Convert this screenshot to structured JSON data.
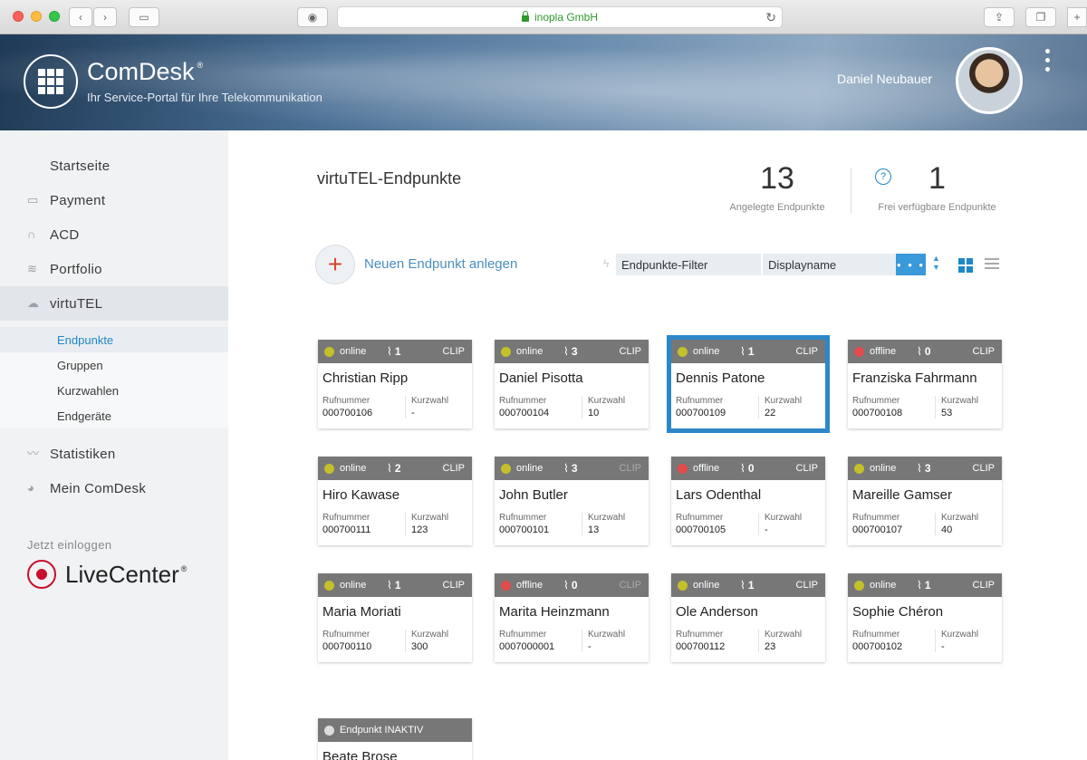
{
  "browser": {
    "address": "inopla GmbH"
  },
  "header": {
    "brand": "ComDesk",
    "brand_mark": "®",
    "tagline": "Ihr Service-Portal für Ihre Telekommunikation",
    "user_name": "Daniel Neubauer"
  },
  "sidebar": {
    "items": [
      {
        "label": "Startseite",
        "icon": "home-icon"
      },
      {
        "label": "Payment",
        "icon": "folder-icon"
      },
      {
        "label": "ACD",
        "icon": "headset-icon"
      },
      {
        "label": "Portfolio",
        "icon": "layers-icon"
      },
      {
        "label": "virtuTEL",
        "icon": "cloud-icon"
      }
    ],
    "sub_items": [
      "Endpunkte",
      "Gruppen",
      "Kurzwahlen",
      "Endgeräte"
    ],
    "bottom_items": [
      {
        "label": "Statistiken",
        "icon": "chart-icon"
      },
      {
        "label": "Mein ComDesk",
        "icon": "user-icon"
      }
    ],
    "login_hint": "Jetzt einloggen",
    "livecenter": "LiveCenter",
    "livecenter_mark": "®"
  },
  "main": {
    "title": "virtuTEL-Endpunkte",
    "stats": [
      {
        "value": "13",
        "label": "Angelegte Endpunkte"
      },
      {
        "value": "1",
        "label": "Frei verfügbare Endpunkte"
      }
    ],
    "add_label": "Neuen Endpunkt anlegen",
    "filter_value": "Endpunkte-Filter",
    "sort_value": "Displayname",
    "filter_more": "• • •",
    "col_label_1": "Rufnummer",
    "col_label_2": "Kurzwahl"
  },
  "colors": {
    "online": "#c3c02a",
    "offline": "#e44b4b",
    "inactive": "#dddddd",
    "accent": "#2b87c8"
  },
  "cards": [
    {
      "status": "online",
      "count": "1",
      "clip": "CLIP",
      "clip_dim": false,
      "name": "Christian Ripp",
      "number": "000700106",
      "short": "-"
    },
    {
      "status": "online",
      "count": "3",
      "clip": "CLIP",
      "clip_dim": false,
      "name": "Daniel Pisotta",
      "number": "000700104",
      "short": "10"
    },
    {
      "status": "online",
      "count": "1",
      "clip": "CLIP",
      "clip_dim": false,
      "name": "Dennis Patone",
      "number": "000700109",
      "short": "22",
      "selected": true
    },
    {
      "status": "offline",
      "count": "0",
      "clip": "CLIP",
      "clip_dim": false,
      "name": "Franziska Fahrmann",
      "number": "000700108",
      "short": "53"
    },
    {
      "status": "online",
      "count": "2",
      "clip": "CLIP",
      "clip_dim": false,
      "name": "Hiro Kawase",
      "number": "000700111",
      "short": "123"
    },
    {
      "status": "online",
      "count": "3",
      "clip": "CLIP",
      "clip_dim": true,
      "name": "John Butler",
      "number": "000700101",
      "short": "13"
    },
    {
      "status": "offline",
      "count": "0",
      "clip": "CLIP",
      "clip_dim": false,
      "name": "Lars Odenthal",
      "number": "000700105",
      "short": "-"
    },
    {
      "status": "online",
      "count": "3",
      "clip": "CLIP",
      "clip_dim": false,
      "name": "Mareille Gamser",
      "number": "000700107",
      "short": "40"
    },
    {
      "status": "online",
      "count": "1",
      "clip": "CLIP",
      "clip_dim": false,
      "name": "Maria Moriati",
      "number": "000700110",
      "short": "300"
    },
    {
      "status": "offline",
      "count": "0",
      "clip": "CLIP",
      "clip_dim": true,
      "name": "Marita Heinzmann",
      "number": "0007000001",
      "short": "-"
    },
    {
      "status": "online",
      "count": "1",
      "clip": "CLIP",
      "clip_dim": false,
      "name": "Ole Anderson",
      "number": "000700112",
      "short": "23"
    },
    {
      "status": "online",
      "count": "1",
      "clip": "CLIP",
      "clip_dim": false,
      "name": "Sophie Chéron",
      "number": "000700102",
      "short": "-"
    }
  ],
  "inactive_card": {
    "status_text": "Endpunkt INAKTIV",
    "name": "Beate Brose"
  }
}
